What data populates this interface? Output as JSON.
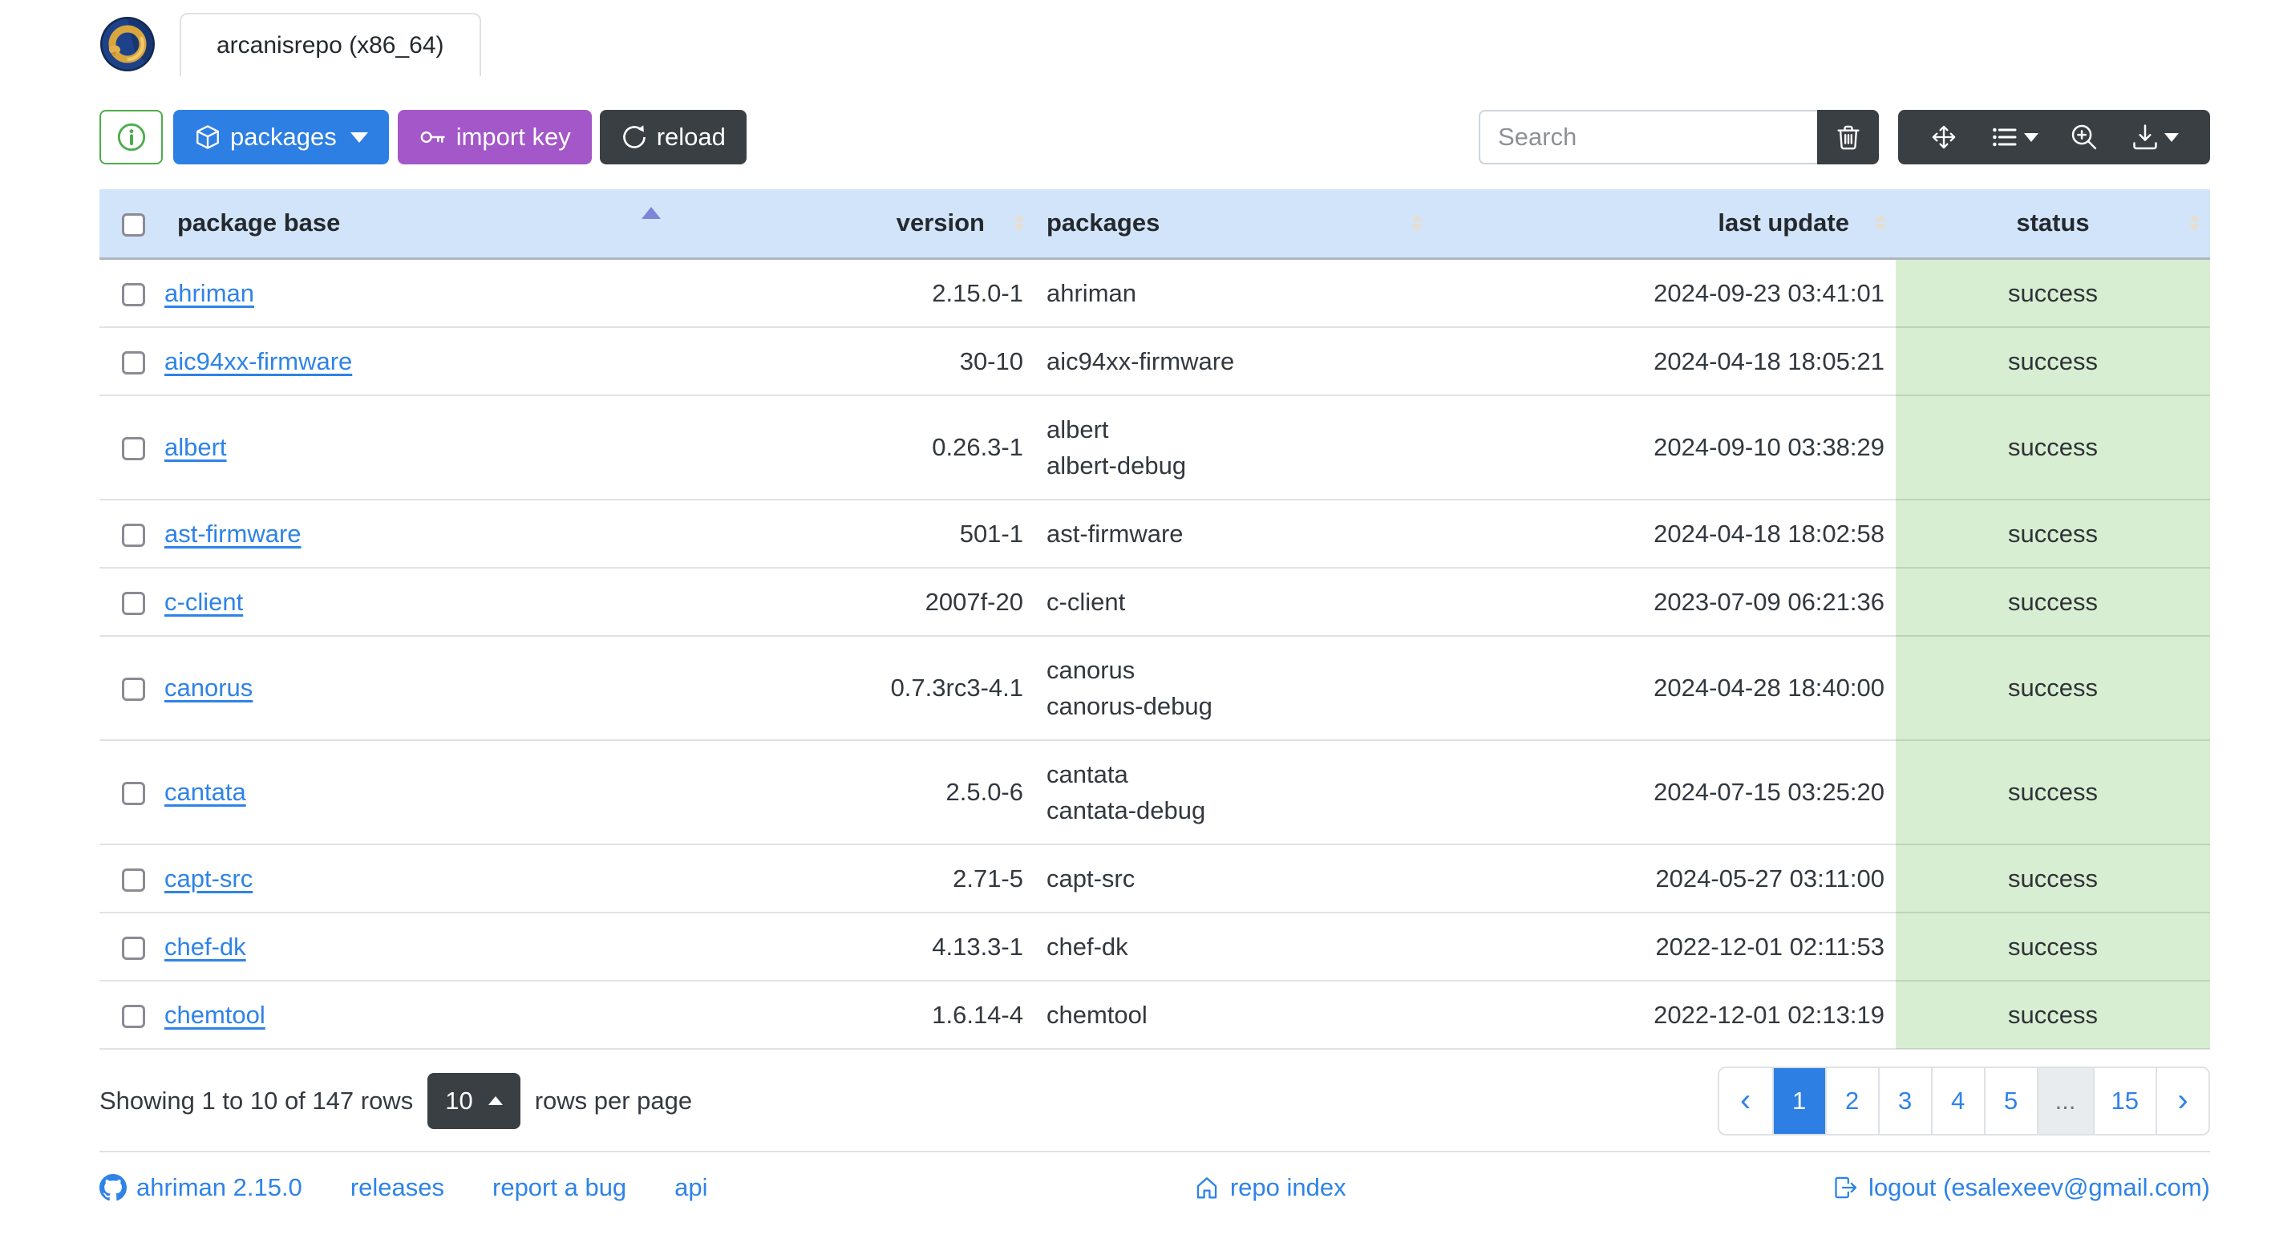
{
  "app": {
    "tab_label": "arcanisrepo (x86_64)"
  },
  "toolbar": {
    "packages_label": "packages",
    "import_key_label": "import key",
    "reload_label": "reload",
    "search_placeholder": "Search"
  },
  "icons": {
    "app-logo": "gold-dragon-ring-on-blue-circle",
    "info-icon": "info-circle",
    "package-box-icon": "box",
    "key-icon": "key",
    "reload-icon": "arrow-clockwise",
    "trash-icon": "trash",
    "arrows-move-icon": "arrows-move",
    "list-icon": "list-ul",
    "zoom-in-icon": "zoom-in",
    "download-icon": "download",
    "github-icon": "github",
    "house-icon": "house",
    "logout-icon": "box-arrow-right"
  },
  "table": {
    "columns": [
      "package base",
      "version",
      "packages",
      "last update",
      "status"
    ],
    "sorted_by": {
      "column": "package base",
      "direction": "asc"
    },
    "rows": [
      {
        "base": "ahriman",
        "version": "2.15.0-1",
        "packages": [
          "ahriman"
        ],
        "last_update": "2024-09-23 03:41:01",
        "status": "success"
      },
      {
        "base": "aic94xx-firmware",
        "version": "30-10",
        "packages": [
          "aic94xx-firmware"
        ],
        "last_update": "2024-04-18 18:05:21",
        "status": "success"
      },
      {
        "base": "albert",
        "version": "0.26.3-1",
        "packages": [
          "albert",
          "albert-debug"
        ],
        "last_update": "2024-09-10 03:38:29",
        "status": "success"
      },
      {
        "base": "ast-firmware",
        "version": "501-1",
        "packages": [
          "ast-firmware"
        ],
        "last_update": "2024-04-18 18:02:58",
        "status": "success"
      },
      {
        "base": "c-client",
        "version": "2007f-20",
        "packages": [
          "c-client"
        ],
        "last_update": "2023-07-09 06:21:36",
        "status": "success"
      },
      {
        "base": "canorus",
        "version": "0.7.3rc3-4.1",
        "packages": [
          "canorus",
          "canorus-debug"
        ],
        "last_update": "2024-04-28 18:40:00",
        "status": "success"
      },
      {
        "base": "cantata",
        "version": "2.5.0-6",
        "packages": [
          "cantata",
          "cantata-debug"
        ],
        "last_update": "2024-07-15 03:25:20",
        "status": "success"
      },
      {
        "base": "capt-src",
        "version": "2.71-5",
        "packages": [
          "capt-src"
        ],
        "last_update": "2024-05-27 03:11:00",
        "status": "success"
      },
      {
        "base": "chef-dk",
        "version": "4.13.3-1",
        "packages": [
          "chef-dk"
        ],
        "last_update": "2022-12-01 02:11:53",
        "status": "success"
      },
      {
        "base": "chemtool",
        "version": "1.6.14-4",
        "packages": [
          "chemtool"
        ],
        "last_update": "2022-12-01 02:13:19",
        "status": "success"
      }
    ]
  },
  "pagination": {
    "summary": "Showing 1 to 10 of 147 rows",
    "page_size": "10",
    "rows_per_page_label": "rows per page",
    "prev": "‹",
    "next": "›",
    "pages": [
      "1",
      "2",
      "3",
      "4",
      "5",
      "...",
      "15"
    ],
    "active_page": "1"
  },
  "footer": {
    "version_link": "ahriman 2.15.0",
    "releases_link": "releases",
    "report_bug_link": "report a bug",
    "api_link": "api",
    "repo_index_link": "repo index",
    "logout_link": "logout (esalexeev@gmail.com)"
  },
  "colors": {
    "accent_blue": "#2d7fe3",
    "purple": "#a357c8",
    "dark": "#3a3f44",
    "green": "#4cae4c",
    "header_bg": "#d2e4f9",
    "status_success_bg": "#d8eed2",
    "sort_active": "#7c86d8"
  }
}
